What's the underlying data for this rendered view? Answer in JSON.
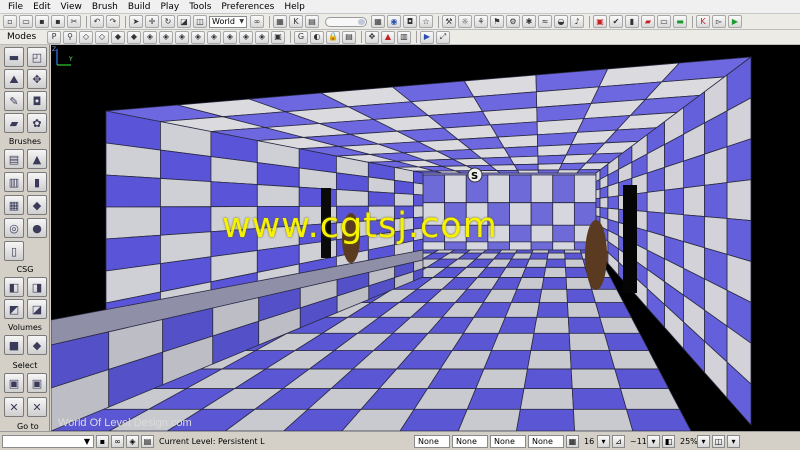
{
  "menubar": {
    "items": [
      "File",
      "Edit",
      "View",
      "Brush",
      "Build",
      "Play",
      "Tools",
      "Preferences",
      "Help"
    ]
  },
  "toolbar": {
    "world_combo": "World",
    "snap_value": "16",
    "rotation_label": "~11",
    "zoom_value": "25%"
  },
  "leftpanel": {
    "modes_label": "Modes",
    "brushes_label": "Brushes",
    "csg_label": "CSG",
    "volumes_label": "Volumes",
    "select_label": "Select",
    "goto_label": "Go to"
  },
  "viewport": {
    "watermark": "www.cgtsj.com",
    "credit": "World Of Level Design.com",
    "axis_z": "Z",
    "axis_y": "Y",
    "pickup_letter": "S"
  },
  "statusbar": {
    "current_level": "Current Level:  Persistent L",
    "fields": [
      "None",
      "None",
      "None",
      "None"
    ]
  },
  "colors": {
    "checker_blue": "#5a55d8",
    "checker_grey": "#cfcfd6",
    "watermark_yellow": "#f6f200",
    "play_green": "#1a9a2a"
  }
}
